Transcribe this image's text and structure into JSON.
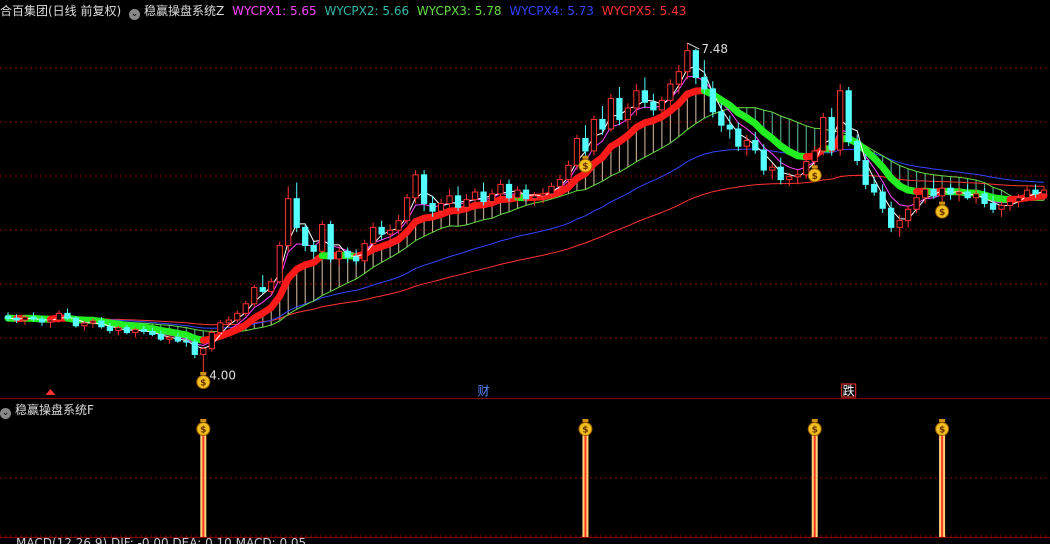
{
  "main_header": {
    "stock_title": "合百集团(日线 前复权)",
    "indicator_name": "稳赢操盘系统Z",
    "lines": [
      {
        "label": "WYCPX1: 5.65",
        "color": "#ff44ff"
      },
      {
        "label": "WYCPX2: 5.66",
        "color": "#33bbaa"
      },
      {
        "label": "WYCPX3: 5.78",
        "color": "#66dd44"
      },
      {
        "label": "WYCPX4: 5.73",
        "color": "#3344ff"
      },
      {
        "label": "WYCPX5: 5.43",
        "color": "#ff3333"
      }
    ]
  },
  "annotations": {
    "high_price": "7.48",
    "low_price": "4.00",
    "event_cai": "财",
    "event_die": "跌"
  },
  "sub_header": {
    "indicator_name": "稳赢操盘系统F"
  },
  "bottom_header": {
    "text": "MACD(12,26,9) DIF: -0.00 DEA: 0.10 MACD: 0.05"
  },
  "colors": {
    "up": "#ff3232",
    "down": "#54ffff",
    "ma_white": "#ffffff",
    "ma_magenta": "#ff44ff",
    "ma_green": "#66dd44",
    "ma_blue": "#3344ff",
    "ma_red": "#ff3333",
    "grid": "#8b0000"
  },
  "chart_data": {
    "type": "candlestick",
    "title": "合百集团(日线 前复权)",
    "price_high": 7.48,
    "price_low": 4.0,
    "price_range": [
      3.9,
      7.7
    ],
    "ohlc": [
      [
        4.62,
        4.66,
        4.57,
        4.6
      ],
      [
        4.6,
        4.64,
        4.55,
        4.58
      ],
      [
        4.58,
        4.63,
        4.53,
        4.61
      ],
      [
        4.61,
        4.66,
        4.57,
        4.59
      ],
      [
        4.59,
        4.62,
        4.52,
        4.56
      ],
      [
        4.56,
        4.6,
        4.5,
        4.58
      ],
      [
        4.58,
        4.68,
        4.55,
        4.65
      ],
      [
        4.65,
        4.7,
        4.58,
        4.6
      ],
      [
        4.6,
        4.62,
        4.5,
        4.52
      ],
      [
        4.52,
        4.57,
        4.47,
        4.55
      ],
      [
        4.55,
        4.6,
        4.5,
        4.57
      ],
      [
        4.57,
        4.61,
        4.49,
        4.51
      ],
      [
        4.51,
        4.55,
        4.44,
        4.47
      ],
      [
        4.47,
        4.52,
        4.42,
        4.5
      ],
      [
        4.5,
        4.53,
        4.43,
        4.45
      ],
      [
        4.45,
        4.5,
        4.4,
        4.48
      ],
      [
        4.48,
        4.52,
        4.43,
        4.46
      ],
      [
        4.46,
        4.5,
        4.41,
        4.43
      ],
      [
        4.43,
        4.47,
        4.36,
        4.38
      ],
      [
        4.38,
        4.42,
        4.33,
        4.4
      ],
      [
        4.4,
        4.44,
        4.34,
        4.36
      ],
      [
        4.36,
        4.4,
        4.3,
        4.35
      ],
      [
        4.35,
        4.38,
        4.18,
        4.22
      ],
      [
        4.22,
        4.3,
        4.0,
        4.28
      ],
      [
        4.28,
        4.48,
        4.25,
        4.45
      ],
      [
        4.45,
        4.58,
        4.42,
        4.55
      ],
      [
        4.55,
        4.62,
        4.5,
        4.58
      ],
      [
        4.58,
        4.68,
        4.55,
        4.65
      ],
      [
        4.65,
        4.78,
        4.62,
        4.75
      ],
      [
        4.75,
        4.95,
        4.72,
        4.92
      ],
      [
        4.92,
        5.05,
        4.85,
        4.88
      ],
      [
        4.88,
        5.02,
        4.84,
        4.98
      ],
      [
        4.98,
        5.4,
        4.96,
        5.36
      ],
      [
        5.36,
        5.98,
        5.3,
        5.85
      ],
      [
        5.85,
        6.02,
        5.5,
        5.55
      ],
      [
        5.55,
        5.58,
        5.3,
        5.36
      ],
      [
        5.36,
        5.4,
        5.22,
        5.3
      ],
      [
        5.3,
        5.62,
        5.28,
        5.58
      ],
      [
        5.58,
        5.62,
        5.18,
        5.22
      ],
      [
        5.22,
        5.35,
        5.15,
        5.3
      ],
      [
        5.3,
        5.34,
        5.18,
        5.24
      ],
      [
        5.24,
        5.32,
        5.16,
        5.2
      ],
      [
        5.2,
        5.42,
        5.18,
        5.38
      ],
      [
        5.38,
        5.6,
        5.34,
        5.55
      ],
      [
        5.55,
        5.62,
        5.42,
        5.48
      ],
      [
        5.48,
        5.58,
        5.4,
        5.52
      ],
      [
        5.52,
        5.68,
        5.48,
        5.62
      ],
      [
        5.62,
        5.9,
        5.58,
        5.86
      ],
      [
        5.86,
        6.15,
        5.8,
        6.1
      ],
      [
        6.1,
        6.15,
        5.72,
        5.8
      ],
      [
        5.8,
        5.88,
        5.66,
        5.72
      ],
      [
        5.72,
        5.85,
        5.68,
        5.8
      ],
      [
        5.8,
        5.95,
        5.76,
        5.88
      ],
      [
        5.88,
        5.98,
        5.72,
        5.76
      ],
      [
        5.76,
        5.9,
        5.7,
        5.84
      ],
      [
        5.84,
        5.96,
        5.8,
        5.92
      ],
      [
        5.92,
        6.02,
        5.78,
        5.82
      ],
      [
        5.82,
        5.95,
        5.76,
        5.9
      ],
      [
        5.9,
        6.05,
        5.86,
        6.0
      ],
      [
        6.0,
        6.05,
        5.82,
        5.86
      ],
      [
        5.86,
        5.98,
        5.8,
        5.94
      ],
      [
        5.94,
        6.0,
        5.82,
        5.85
      ],
      [
        5.85,
        5.92,
        5.78,
        5.88
      ],
      [
        5.88,
        5.96,
        5.8,
        5.9
      ],
      [
        5.9,
        6.02,
        5.86,
        5.98
      ],
      [
        5.98,
        6.1,
        5.92,
        6.05
      ],
      [
        6.05,
        6.25,
        6.0,
        6.2
      ],
      [
        6.2,
        6.52,
        6.15,
        6.48
      ],
      [
        6.48,
        6.62,
        6.3,
        6.35
      ],
      [
        6.35,
        6.72,
        6.3,
        6.68
      ],
      [
        6.68,
        6.82,
        6.52,
        6.58
      ],
      [
        6.58,
        6.95,
        6.55,
        6.9
      ],
      [
        6.9,
        7.02,
        6.62,
        6.68
      ],
      [
        6.68,
        6.85,
        6.58,
        6.8
      ],
      [
        6.8,
        7.05,
        6.72,
        6.98
      ],
      [
        6.98,
        7.12,
        6.8,
        6.86
      ],
      [
        6.86,
        6.95,
        6.72,
        6.78
      ],
      [
        6.78,
        6.92,
        6.7,
        6.88
      ],
      [
        6.88,
        7.1,
        6.82,
        7.05
      ],
      [
        7.05,
        7.25,
        6.95,
        7.18
      ],
      [
        7.18,
        7.48,
        7.1,
        7.4
      ],
      [
        7.4,
        7.42,
        7.05,
        7.12
      ],
      [
        7.12,
        7.3,
        6.95,
        7.0
      ],
      [
        7.0,
        7.08,
        6.7,
        6.76
      ],
      [
        6.76,
        6.85,
        6.55,
        6.62
      ],
      [
        6.62,
        6.72,
        6.48,
        6.58
      ],
      [
        6.58,
        6.65,
        6.35,
        6.4
      ],
      [
        6.4,
        6.52,
        6.3,
        6.46
      ],
      [
        6.46,
        6.55,
        6.32,
        6.36
      ],
      [
        6.36,
        6.42,
        6.1,
        6.15
      ],
      [
        6.15,
        6.22,
        6.05,
        6.18
      ],
      [
        6.18,
        6.28,
        6.0,
        6.05
      ],
      [
        6.05,
        6.12,
        5.98,
        6.08
      ],
      [
        6.08,
        6.15,
        6.0,
        6.1
      ],
      [
        6.1,
        6.3,
        6.06,
        6.24
      ],
      [
        6.24,
        6.4,
        6.2,
        6.35
      ],
      [
        6.35,
        6.75,
        6.3,
        6.7
      ],
      [
        6.7,
        6.8,
        6.3,
        6.36
      ],
      [
        6.36,
        7.05,
        6.3,
        6.98
      ],
      [
        6.98,
        7.02,
        6.4,
        6.45
      ],
      [
        6.45,
        6.52,
        6.2,
        6.25
      ],
      [
        6.25,
        6.32,
        5.95,
        6.0
      ],
      [
        6.0,
        6.08,
        5.88,
        5.92
      ],
      [
        5.92,
        6.0,
        5.7,
        5.75
      ],
      [
        5.75,
        5.82,
        5.5,
        5.55
      ],
      [
        5.55,
        5.68,
        5.45,
        5.62
      ],
      [
        5.62,
        5.78,
        5.55,
        5.74
      ],
      [
        5.74,
        5.92,
        5.7,
        5.86
      ],
      [
        5.86,
        5.98,
        5.8,
        5.95
      ],
      [
        5.95,
        6.05,
        5.85,
        5.88
      ],
      [
        5.88,
        6.0,
        5.82,
        5.96
      ],
      [
        5.96,
        6.0,
        5.84,
        5.9
      ],
      [
        5.9,
        5.98,
        5.82,
        5.92
      ],
      [
        5.92,
        6.0,
        5.84,
        5.86
      ],
      [
        5.86,
        5.95,
        5.8,
        5.9
      ],
      [
        5.9,
        5.96,
        5.76,
        5.8
      ],
      [
        5.8,
        5.88,
        5.7,
        5.74
      ],
      [
        5.74,
        5.82,
        5.66,
        5.78
      ],
      [
        5.78,
        5.86,
        5.72,
        5.82
      ],
      [
        5.82,
        5.9,
        5.76,
        5.86
      ],
      [
        5.86,
        5.98,
        5.82,
        5.94
      ],
      [
        5.94,
        6.0,
        5.86,
        5.9
      ],
      [
        5.9,
        5.98,
        5.84,
        5.94
      ]
    ],
    "buy_signal_bars": [
      23,
      68,
      95,
      110
    ],
    "event_bars": {
      "cai": 56,
      "die": 99,
      "up_arrow": 5
    }
  }
}
